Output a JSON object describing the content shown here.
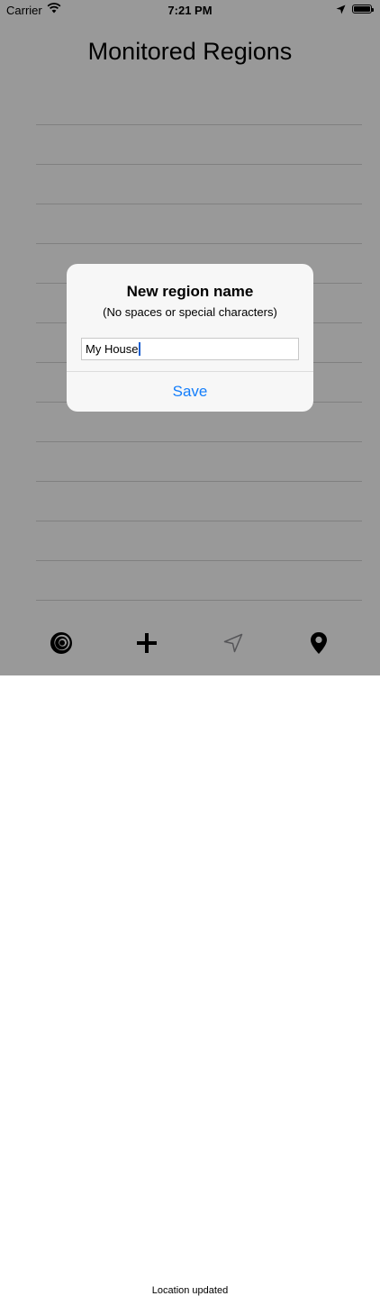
{
  "status_bar": {
    "carrier": "Carrier",
    "time": "7:21 PM"
  },
  "page": {
    "title": "Monitored Regions",
    "rows": [
      "",
      "",
      "",
      "",
      "",
      "",
      "",
      "",
      "",
      "",
      "",
      "",
      ""
    ]
  },
  "tab_bar": {
    "items": [
      {
        "icon": "radar-icon"
      },
      {
        "icon": "plus-icon"
      },
      {
        "icon": "location-arrow-icon",
        "color": "#8e8e93"
      },
      {
        "icon": "map-pin-icon"
      }
    ],
    "status_text": "Location updated"
  },
  "alert": {
    "title": "New region name",
    "message": "(No spaces or special characters)",
    "input_value": "My House",
    "button_label": "Save",
    "button_color": "#147efb"
  }
}
